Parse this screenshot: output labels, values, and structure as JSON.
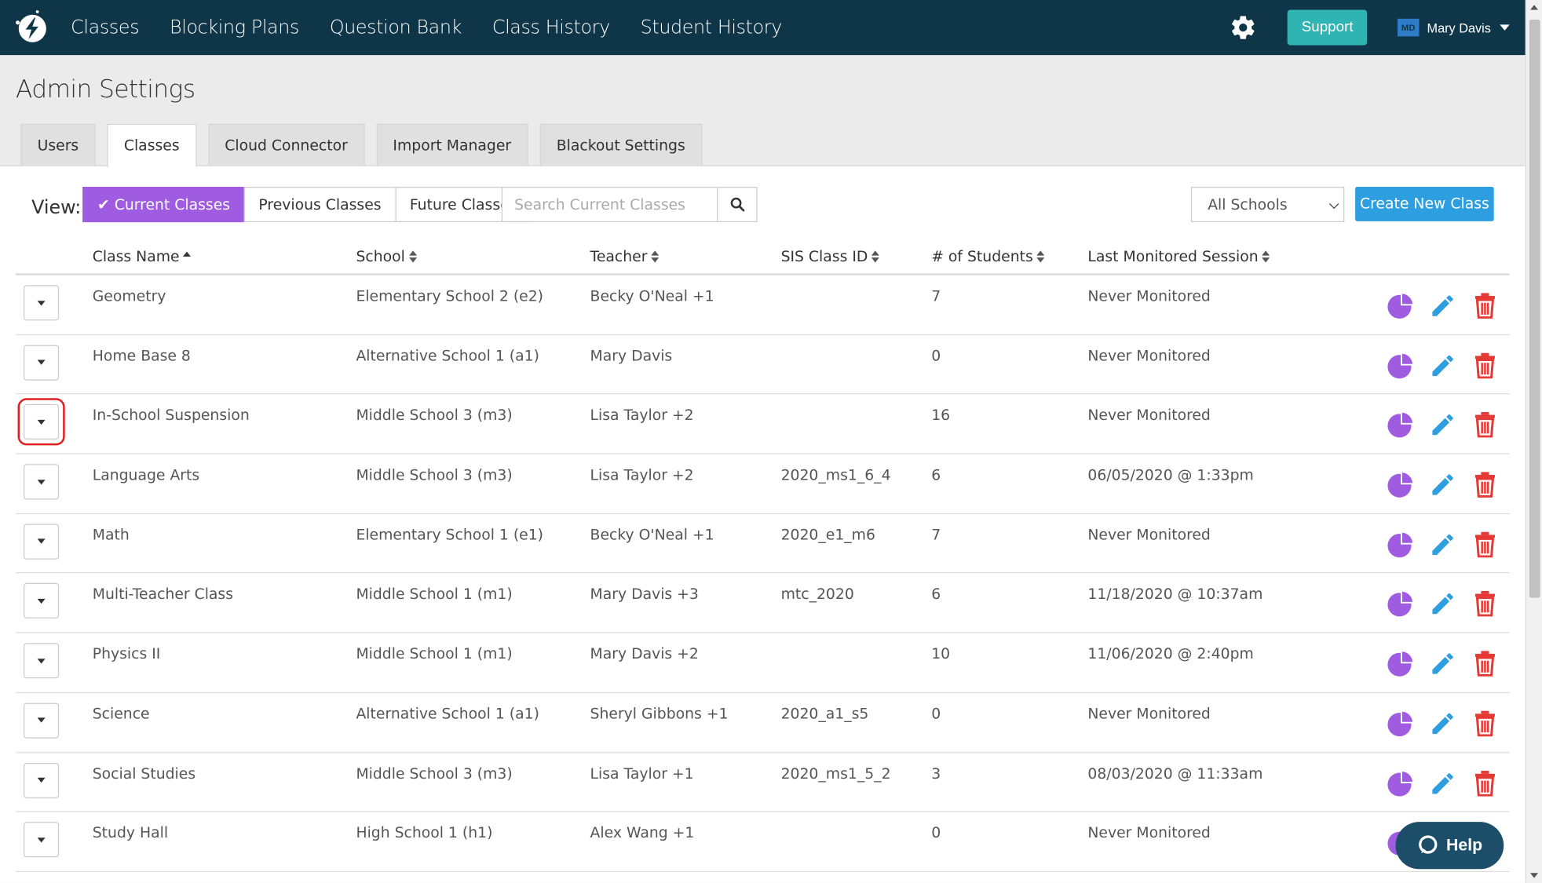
{
  "nav": {
    "links": [
      "Classes",
      "Blocking Plans",
      "Question Bank",
      "Class History",
      "Student History"
    ],
    "support_label": "Support",
    "user_initials": "MD",
    "user_name": "Mary Davis"
  },
  "page": {
    "title": "Admin Settings",
    "tabs": [
      "Users",
      "Classes",
      "Cloud Connector",
      "Import Manager",
      "Blackout Settings"
    ],
    "active_tab": "Classes"
  },
  "toolbar": {
    "view_label": "View:",
    "view_options": [
      "Current Classes",
      "Previous Classes",
      "Future Classes"
    ],
    "active_view": "Current Classes",
    "search_placeholder": "Search Current Classes",
    "school_filter": "All Schools",
    "create_label": "Create New Class"
  },
  "table": {
    "columns": [
      "Class Name",
      "School",
      "Teacher",
      "SIS Class ID",
      "# of Students",
      "Last Monitored Session"
    ],
    "rows": [
      {
        "name": "Geometry",
        "school": "Elementary School 2 (e2)",
        "teacher": "Becky O'Neal +1",
        "sis": "",
        "students": "7",
        "last": "Never Monitored"
      },
      {
        "name": "Home Base 8",
        "school": "Alternative School 1 (a1)",
        "teacher": "Mary Davis",
        "sis": "",
        "students": "0",
        "last": "Never Monitored"
      },
      {
        "name": "In-School Suspension",
        "school": "Middle School 3 (m3)",
        "teacher": "Lisa Taylor +2",
        "sis": "",
        "students": "16",
        "last": "Never Monitored"
      },
      {
        "name": "Language Arts",
        "school": "Middle School 3 (m3)",
        "teacher": "Lisa Taylor +2",
        "sis": "2020_ms1_6_4",
        "students": "6",
        "last": "06/05/2020 @ 1:33pm"
      },
      {
        "name": "Math",
        "school": "Elementary School 1 (e1)",
        "teacher": "Becky O'Neal +1",
        "sis": "2020_e1_m6",
        "students": "7",
        "last": "Never Monitored"
      },
      {
        "name": "Multi-Teacher Class",
        "school": "Middle School 1 (m1)",
        "teacher": "Mary Davis +3",
        "sis": "mtc_2020",
        "students": "6",
        "last": "11/18/2020 @ 10:37am"
      },
      {
        "name": "Physics II",
        "school": "Middle School 1 (m1)",
        "teacher": "Mary Davis +2",
        "sis": "",
        "students": "10",
        "last": "11/06/2020 @ 2:40pm"
      },
      {
        "name": "Science",
        "school": "Alternative School 1 (a1)",
        "teacher": "Sheryl Gibbons +1",
        "sis": "2020_a1_s5",
        "students": "0",
        "last": "Never Monitored"
      },
      {
        "name": "Social Studies",
        "school": "Middle School 3 (m3)",
        "teacher": "Lisa Taylor +1",
        "sis": "2020_ms1_5_2",
        "students": "3",
        "last": "08/03/2020 @ 11:33am"
      },
      {
        "name": "Study Hall",
        "school": "High School 1 (h1)",
        "teacher": "Alex Wang +1",
        "sis": "",
        "students": "0",
        "last": "Never Monitored"
      }
    ]
  },
  "help_label": "Help",
  "colors": {
    "navbar": "#0f3548",
    "accent_purple": "#a05ce0",
    "support": "#2fb3b3",
    "create": "#2d9fe0",
    "delete": "#e53935",
    "edit": "#2d9fe0",
    "highlight": "#e02020"
  },
  "icons": {
    "logo": "lightning-logo-icon",
    "settings": "gear-icon",
    "search": "search-icon",
    "report": "pie-chart-icon",
    "edit": "pencil-icon",
    "delete": "trash-icon",
    "help": "chat-bubble-icon"
  }
}
